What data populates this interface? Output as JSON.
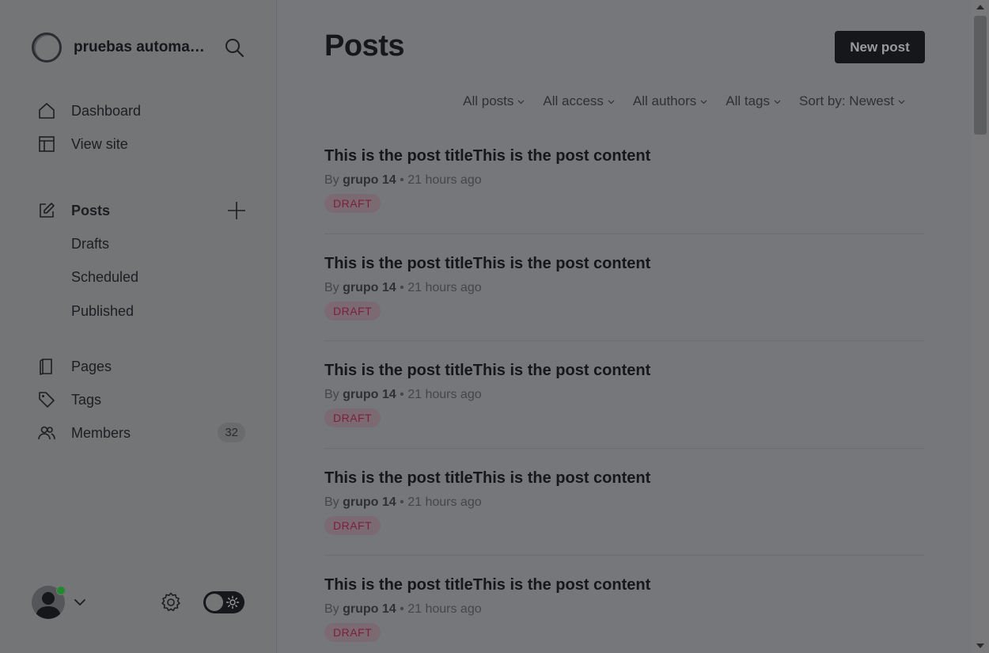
{
  "brand": {
    "name": "pruebas automatizadas",
    "logo_icon": "ghost-logo-icon"
  },
  "search": {
    "icon": "search-icon"
  },
  "sidebar": {
    "main_items": [
      {
        "label": "Dashboard",
        "icon": "home-icon"
      },
      {
        "label": "View site",
        "icon": "layout-icon"
      }
    ],
    "posts": {
      "label": "Posts",
      "icon": "edit-icon",
      "sub_items": [
        {
          "label": "Drafts"
        },
        {
          "label": "Scheduled"
        },
        {
          "label": "Published"
        }
      ]
    },
    "other_items": [
      {
        "label": "Pages",
        "icon": "page-icon"
      },
      {
        "label": "Tags",
        "icon": "tag-icon"
      },
      {
        "label": "Members",
        "icon": "members-icon",
        "count": "32"
      }
    ]
  },
  "header": {
    "title": "Posts",
    "new_post_label": "New post"
  },
  "filters": [
    {
      "label": "All posts"
    },
    {
      "label": "All access"
    },
    {
      "label": "All authors"
    },
    {
      "label": "All tags"
    },
    {
      "label": "Sort by: Newest"
    }
  ],
  "posts": [
    {
      "title": "This is the post titleThis is the post content",
      "by": "By",
      "author": "grupo 14",
      "sep": "•",
      "time": "21 hours ago",
      "status": "DRAFT"
    },
    {
      "title": "This is the post titleThis is the post content",
      "by": "By",
      "author": "grupo 14",
      "sep": "•",
      "time": "21 hours ago",
      "status": "DRAFT"
    },
    {
      "title": "This is the post titleThis is the post content",
      "by": "By",
      "author": "grupo 14",
      "sep": "•",
      "time": "21 hours ago",
      "status": "DRAFT"
    },
    {
      "title": "This is the post titleThis is the post content",
      "by": "By",
      "author": "grupo 14",
      "sep": "•",
      "time": "21 hours ago",
      "status": "DRAFT"
    },
    {
      "title": "This is the post titleThis is the post content",
      "by": "By",
      "author": "grupo 14",
      "sep": "•",
      "time": "21 hours ago",
      "status": "DRAFT"
    }
  ],
  "colors": {
    "overlay_bg": "#76777a",
    "primary_button": "#15171a",
    "draft_badge_bg": "#7b6a71",
    "draft_badge_text": "#7d1f3c",
    "online_dot": "#1f8a2e"
  }
}
